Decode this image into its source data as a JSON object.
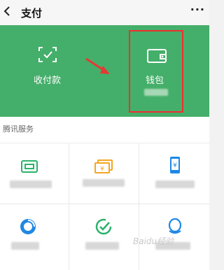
{
  "header": {
    "back_icon": "chevron-left-icon",
    "title": "支付",
    "more_label": "···"
  },
  "hero": {
    "pay": {
      "label": "收付款",
      "icon": "scan-icon"
    },
    "wallet": {
      "label": "钱包",
      "icon": "wallet-icon"
    },
    "annotation": {
      "arrow_color": "#e53935",
      "box_color": "#ef2f2f"
    }
  },
  "services": {
    "title": "腾讯服务",
    "tiles": [
      {
        "icon": "card-icon"
      },
      {
        "icon": "money-icon"
      },
      {
        "icon": "phone-yuan-icon"
      },
      {
        "icon": "qbi-icon"
      },
      {
        "icon": "check-circle-icon"
      },
      {
        "icon": "qq-icon"
      }
    ]
  },
  "watermark": "Baidu经验",
  "colors": {
    "brand_green": "#44af6a",
    "icon_green": "#2bb26b",
    "icon_orange": "#f5a623",
    "icon_blue": "#1e88e5"
  }
}
